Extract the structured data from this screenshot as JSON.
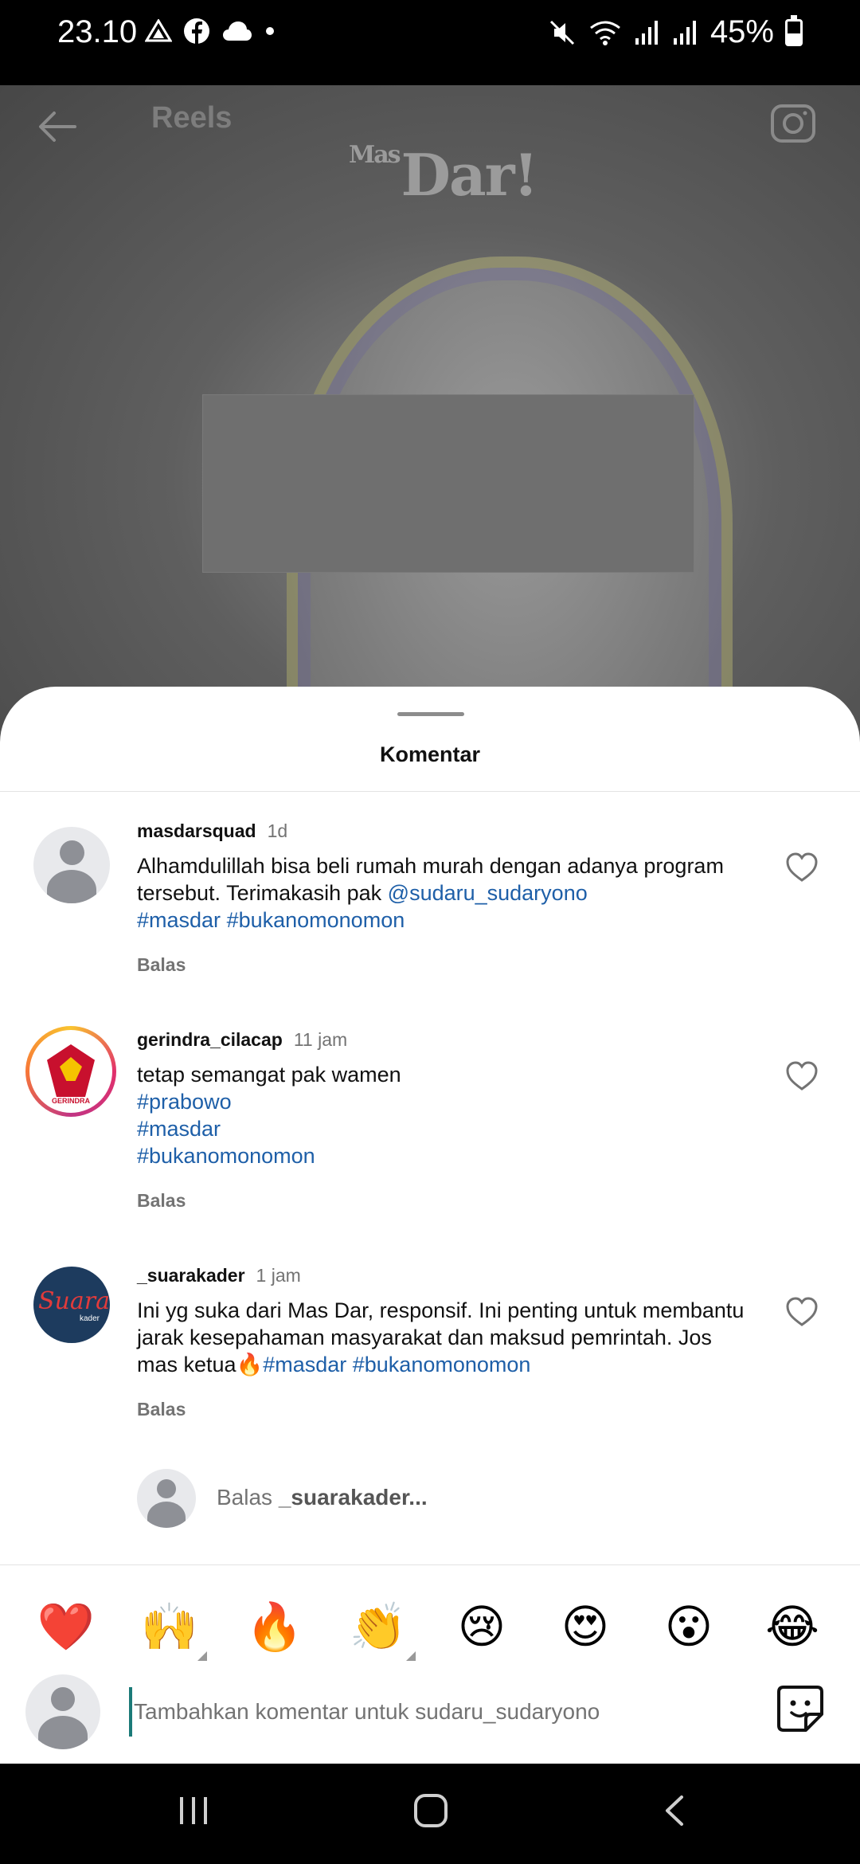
{
  "status_bar": {
    "time": "23.10",
    "battery": "45%",
    "battery_level": 0.45
  },
  "header": {
    "title": "Reels",
    "watermark_prefix": "Mas",
    "watermark": "Dar!"
  },
  "sheet": {
    "title": "Komentar"
  },
  "comments": [
    {
      "username": "masdarsquad",
      "time": "1d",
      "text_plain": "Alhamdulillah bisa beli rumah murah dengan adanya program tersebut. Terimakasih pak ",
      "mention": "@sudaru_sudaryono",
      "hashtags": [
        "#masdar",
        "#bukanomonomon"
      ],
      "reply_label": "Balas"
    },
    {
      "username": "gerindra_cilacap",
      "time": "11 jam",
      "text_plain": "tetap semangat pak wamen",
      "hashtags": [
        "#prabowo",
        "#masdar",
        "#bukanomonomon"
      ],
      "reply_label": "Balas",
      "avatar_text": "GERINDRA"
    },
    {
      "username": "_suarakader",
      "time": "1 jam",
      "text_plain": "Ini yg suka dari Mas Dar,  responsif. Ini penting untuk membantu jarak kesepahaman masyarakat dan maksud pemrintah. Jos mas ketua🔥",
      "hashtags": [
        "#masdar",
        "#bukanomonomon"
      ],
      "reply_label": "Balas",
      "avatar_text_1": "Suara",
      "avatar_text_2": "kader"
    }
  ],
  "reply_box": {
    "prefix": "Balas ",
    "target": "_suarakader..."
  },
  "emoji_bar": [
    {
      "icon": "red-heart",
      "glyph": "❤️"
    },
    {
      "icon": "raising-hands",
      "glyph": "🙌"
    },
    {
      "icon": "fire",
      "glyph": "🔥"
    },
    {
      "icon": "clapping-hands",
      "glyph": "👏"
    },
    {
      "icon": "crying-face",
      "glyph": "😢"
    },
    {
      "icon": "heart-eyes-face",
      "glyph": "😍"
    },
    {
      "icon": "surprised-face",
      "glyph": "😮"
    },
    {
      "icon": "tears-of-joy-face",
      "glyph": "😂"
    }
  ],
  "composer": {
    "placeholder": "Tambahkan komentar untuk sudaru_sudaryono",
    "value": ""
  },
  "colors": {
    "link": "#1e5fa8",
    "muted": "#737373",
    "cursor": "#1b7a78"
  }
}
